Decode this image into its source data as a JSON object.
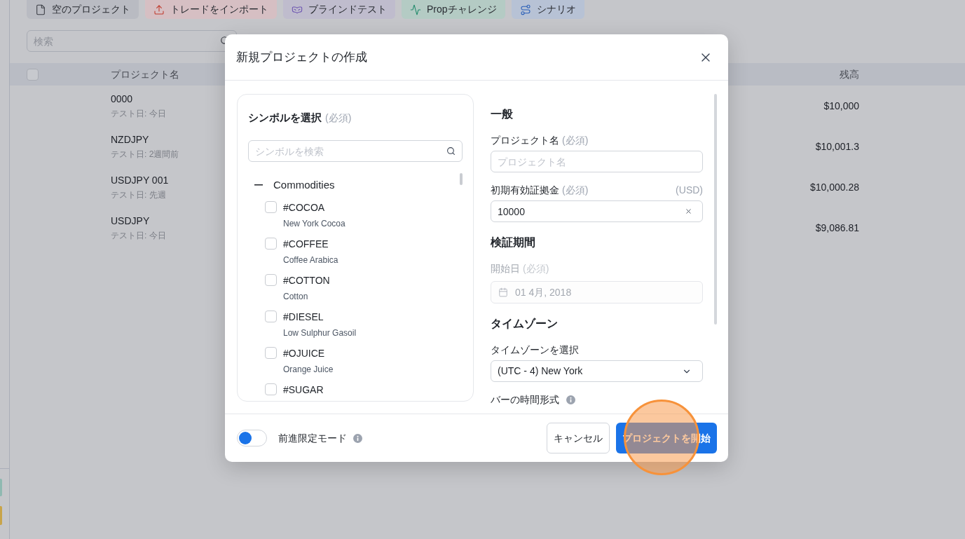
{
  "toolbar": {
    "buttons": [
      {
        "label": "空のプロジェクト",
        "kind": "blank"
      },
      {
        "label": "トレードをインポート",
        "kind": "import"
      },
      {
        "label": "ブラインドテスト",
        "kind": "blind"
      },
      {
        "label": "Propチャレンジ",
        "kind": "prop"
      },
      {
        "label": "シナリオ",
        "kind": "scenario"
      }
    ]
  },
  "search": {
    "placeholder": "検索"
  },
  "table": {
    "select_all": {
      "checked": false
    },
    "columns": [
      "プロジェクト名",
      "残高"
    ],
    "rows": [
      {
        "name": "0000",
        "test_date": "テスト日: 今日",
        "balance": "$10,000"
      },
      {
        "name": "NZDJPY",
        "test_date": "テスト日: 2週間前",
        "balance": "$10,001.3"
      },
      {
        "name": "USDJPY 001",
        "test_date": "テスト日: 先週",
        "balance": "$10,000.28"
      },
      {
        "name": "USDJPY",
        "test_date": "テスト日: 今日",
        "balance": "$9,086.81"
      }
    ]
  },
  "dialog": {
    "title": "新規プロジェクトの作成",
    "symbols": {
      "title": "シンボルを選択",
      "required": "(必須)",
      "search_placeholder": "シンボルを検索",
      "groups": [
        {
          "label": "Commodities",
          "expanded": true,
          "children": [
            {
              "symbol": "#COCOA",
              "description": "New York Cocoa",
              "checked": false
            },
            {
              "symbol": "#COFFEE",
              "description": "Coffee Arabica",
              "checked": false
            },
            {
              "symbol": "#COTTON",
              "description": "Cotton",
              "checked": false
            },
            {
              "symbol": "#DIESEL",
              "description": "Low Sulphur Gasoil",
              "checked": false
            },
            {
              "symbol": "#OJUICE",
              "description": "Orange Juice",
              "checked": false
            },
            {
              "symbol": "#SUGAR",
              "checked": false
            }
          ]
        }
      ]
    },
    "settings": {
      "sections": [
        {
          "title": "一般",
          "fields": [
            {
              "kind": "text",
              "label": "プロジェクト名",
              "required": "(必須)",
              "placeholder": "プロジェクト名",
              "disabled": false
            },
            {
              "kind": "amount",
              "label": "初期有効証拠金",
              "required": "(必須)",
              "unit": "(USD)",
              "value": "10000",
              "disabled": false
            }
          ]
        },
        {
          "title": "検証期間",
          "fields": [
            {
              "kind": "date",
              "label": "開始日",
              "required": "(必須)",
              "value": "01 4月, 2018",
              "disabled": true
            }
          ]
        },
        {
          "title": "タイムゾーン",
          "fields": [
            {
              "kind": "select",
              "label": "タイムゾーンを選択",
              "value": "(UTC - 4) New York",
              "disabled": false
            },
            {
              "kind": "info",
              "label": "バーの時間形式",
              "disabled": false
            }
          ]
        }
      ]
    },
    "footer": {
      "toggle": {
        "label": "前進限定モード",
        "on": false
      },
      "buttons": [
        {
          "label": "キャンセル",
          "kind": "secondary"
        },
        {
          "label": "プロジェクトを開始",
          "kind": "primary"
        }
      ]
    }
  }
}
